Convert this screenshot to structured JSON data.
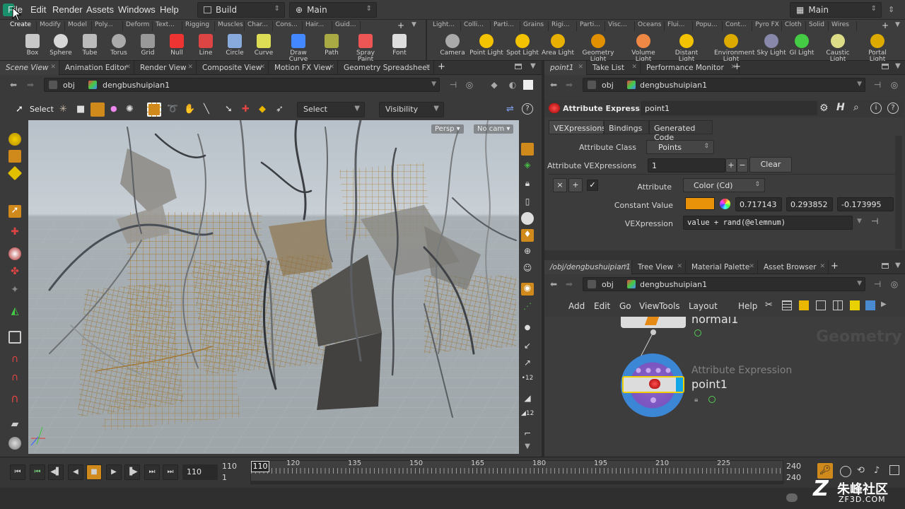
{
  "menubar": {
    "items": [
      "File",
      "Edit",
      "Render",
      "Assets",
      "Windows",
      "Help"
    ],
    "desktop": "Build",
    "context": "Main",
    "right_desktop": "Main"
  },
  "shelf_left": {
    "tabs": [
      "Create",
      "Modify",
      "Model",
      "Poly...",
      "Deform",
      "Text...",
      "Rigging",
      "Muscles",
      "Char...",
      "Cons...",
      "Hair...",
      "Guid..."
    ],
    "tools": [
      "Box",
      "Sphere",
      "Tube",
      "Torus",
      "Grid",
      "Null",
      "Line",
      "Circle",
      "Curve",
      "Draw Curve",
      "Path",
      "Spray Paint",
      "Font"
    ]
  },
  "shelf_right": {
    "tabs": [
      "Light...",
      "Colli...",
      "Parti...",
      "Grains",
      "Rigi...",
      "Parti...",
      "Visc...",
      "Oceans",
      "Flui...",
      "Popu...",
      "Cont...",
      "Pyro FX",
      "Cloth",
      "Solid",
      "Wires"
    ],
    "tools": [
      "Camera",
      "Point Light",
      "Spot Light",
      "Area Light",
      "Geometry Light",
      "Volume Light",
      "Distant Light",
      "Environment Light",
      "Sky Light",
      "GI Light",
      "Caustic Light",
      "Portal Light"
    ]
  },
  "left_pane": {
    "tabs": [
      "Scene View",
      "Animation Editor",
      "Render View",
      "Composite View",
      "Motion FX View",
      "Geometry Spreadsheet"
    ],
    "path": [
      "obj",
      "dengbushuipian1"
    ],
    "select_label": "Select",
    "select_mode": "Select",
    "visibility": "Visibility",
    "persp": "Persp",
    "cam": "No cam"
  },
  "right_top_pane": {
    "tabs": [
      "point1",
      "Take List",
      "Performance Monitor"
    ],
    "path": [
      "obj",
      "dengbushuipian1"
    ],
    "node_type": "Attribute Expression",
    "node_name": "point1",
    "subtabs": [
      "VEXpressions",
      "Bindings",
      "Generated Code"
    ],
    "attribute_class_label": "Attribute Class",
    "attribute_class": "Points",
    "vexpressions_label": "Attribute VEXpressions",
    "vexpressions_count": "1",
    "clear_label": "Clear",
    "attribute_label": "Attribute",
    "attribute_value": "Color (Cd)",
    "constant_label": "Constant Value",
    "constant_color": "#e8920a",
    "constant_values": [
      "0.717143",
      "0.293852",
      "-0.173995"
    ],
    "vexpression_label": "VEXpression",
    "vexpression": "value + rand(@elemnum)"
  },
  "right_bottom_pane": {
    "tabs": [
      "/obj/dengbushuipian1",
      "Tree View",
      "Material Palette",
      "Asset Browser"
    ],
    "path": [
      "obj",
      "dengbushuipian1"
    ],
    "menu": [
      "Add",
      "Edit",
      "Go",
      "View",
      "Tools",
      "Layout",
      "Help"
    ],
    "watermark": "Geometry",
    "node_above": "normal1",
    "node_type": "Attribute Expression",
    "node_name": "point1"
  },
  "timeline": {
    "current_frame": "110",
    "start_frame": "110",
    "start_sub": "1",
    "marker": "110",
    "ticks": [
      "120",
      "135",
      "150",
      "165",
      "180",
      "195",
      "210",
      "225"
    ],
    "end_frame": "240",
    "end_sub": "240"
  },
  "watermark": {
    "text": "朱峰社区",
    "url": "ZF3D.COM"
  }
}
